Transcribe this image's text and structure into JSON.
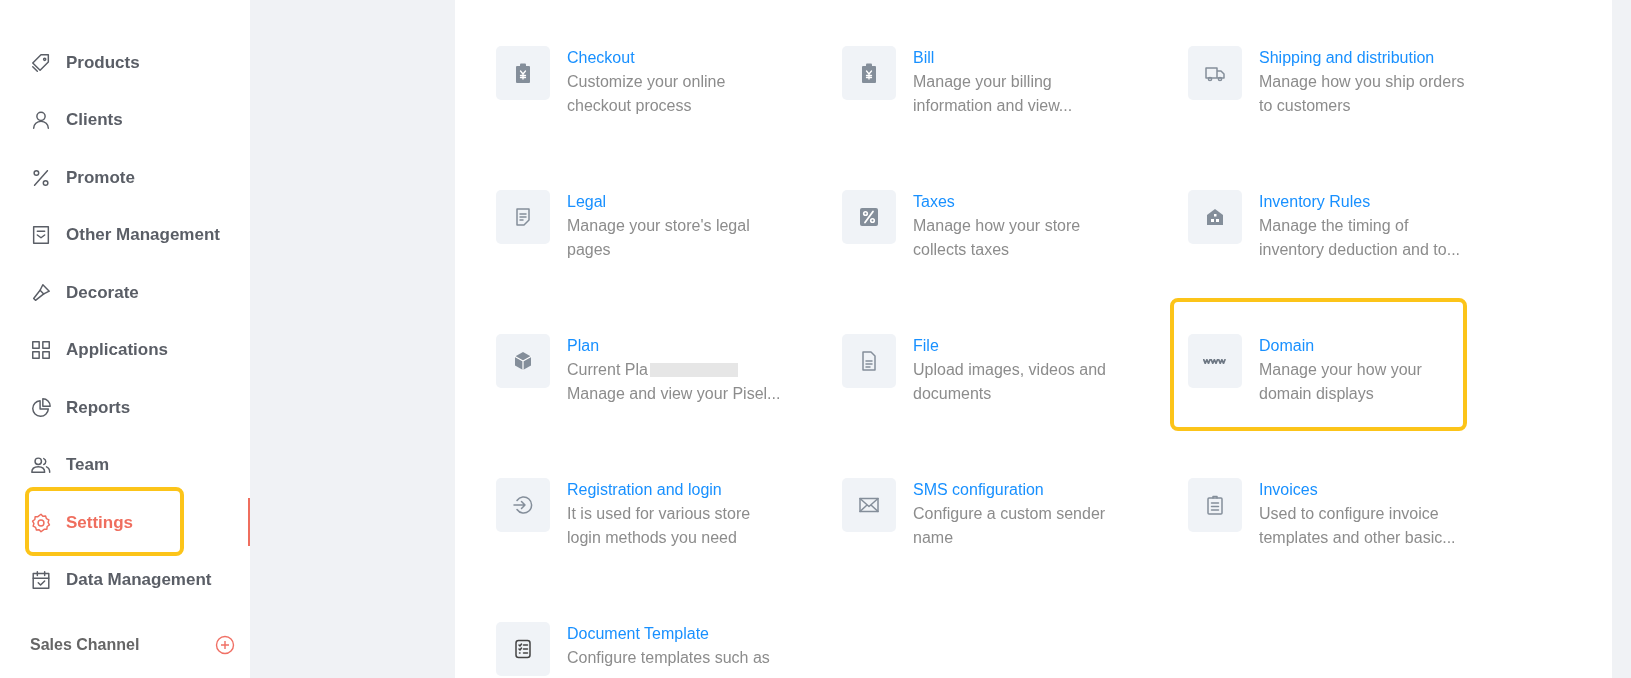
{
  "sidebar": {
    "items": [
      {
        "label": "Products",
        "selected": false,
        "highlighted": false
      },
      {
        "label": "Clients",
        "selected": false,
        "highlighted": false
      },
      {
        "label": "Promote",
        "selected": false,
        "highlighted": false
      },
      {
        "label": "Other Management",
        "selected": false,
        "highlighted": false
      },
      {
        "label": "Decorate",
        "selected": false,
        "highlighted": false
      },
      {
        "label": "Applications",
        "selected": false,
        "highlighted": false
      },
      {
        "label": "Reports",
        "selected": false,
        "highlighted": false
      },
      {
        "label": "Team",
        "selected": false,
        "highlighted": false
      },
      {
        "label": "Settings",
        "selected": true,
        "highlighted": true
      },
      {
        "label": "Data Management",
        "selected": false,
        "highlighted": false
      }
    ],
    "section": {
      "title": "Sales Channel"
    }
  },
  "settings": [
    {
      "title": "Checkout",
      "description": "Customize your online checkout process",
      "highlighted": false
    },
    {
      "title": "Bill",
      "description": "Manage your billing information and view...",
      "highlighted": false
    },
    {
      "title": "Shipping and distribution",
      "description": "Manage how you ship orders to customers",
      "highlighted": false
    },
    {
      "title": "Legal",
      "description": "Manage your store's legal pages",
      "highlighted": false
    },
    {
      "title": "Taxes",
      "description": "Manage how your store collects taxes",
      "highlighted": false
    },
    {
      "title": "Inventory Rules",
      "description": "Manage the timing of inventory deduction and to...",
      "highlighted": false
    },
    {
      "title": "Plan",
      "description": "Current Pla",
      "redacted": true,
      "description_2": "Manage and view your Pisel...",
      "highlighted": false
    },
    {
      "title": "File",
      "description": "Upload images, videos and documents",
      "highlighted": false
    },
    {
      "title": "Domain",
      "description": "Manage your how your domain displays",
      "highlighted": true
    },
    {
      "title": "Registration and login",
      "description": "It is used for various store login methods you need",
      "highlighted": false
    },
    {
      "title": "SMS configuration",
      "description": "Configure a custom sender name",
      "highlighted": false
    },
    {
      "title": "Invoices",
      "description": "Used to configure invoice templates and other basic...",
      "highlighted": false
    },
    {
      "title": "Document Template",
      "description": "Configure templates such as",
      "highlighted": false
    }
  ]
}
